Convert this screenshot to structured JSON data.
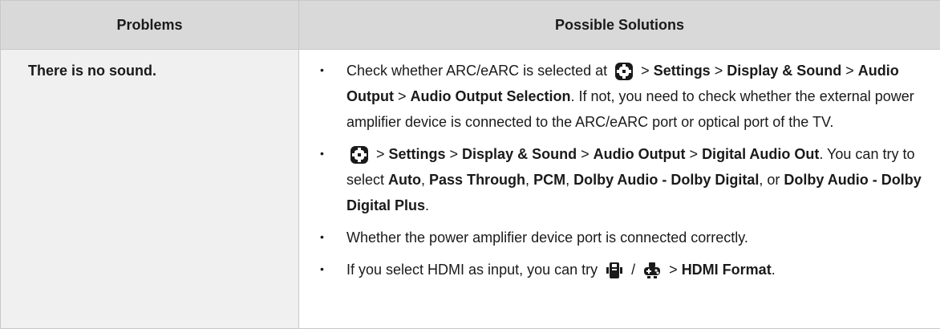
{
  "table": {
    "headers": [
      "Problems",
      "Possible Solutions"
    ],
    "rows": [
      {
        "problem": "There is no sound.",
        "solutions": [
          {
            "t1": "Check whether ARC/eARC is selected at",
            "icon": "settings-icon",
            "t2": " > ",
            "b1": "Settings",
            "t3": " > ",
            "b2": "Display & Sound",
            "t4": " > ",
            "b3": "Audio Output",
            "t5": " > ",
            "b4": "Audio Output Selection",
            "t6": ". If not, you need to check whether the external power amplifier device is connected to the ARC/eARC port or optical port of the TV."
          },
          {
            "icon": "settings-icon",
            "t1": " > ",
            "b1": "Settings",
            "t2": " > ",
            "b2": "Display & Sound",
            "t3": " > ",
            "b3": "Audio Output",
            "t4": " > ",
            "b4": "Digital Audio Out",
            "t5": ". You can try to select ",
            "b5": "Auto",
            "t6": ", ",
            "b6": "Pass Through",
            "t7": ", ",
            "b7": "PCM",
            "t8": ", ",
            "b8": "Dolby Audio - Dolby Digital",
            "t9": ", or ",
            "b9": "Dolby Audio - Dolby Digital Plus",
            "t10": "."
          },
          {
            "t1": "Whether the power amplifier device port is connected correctly."
          },
          {
            "t1": "If you select HDMI as input, you can try",
            "icon1": "input-icon",
            "t2": " / ",
            "icon2": "gamepad-icon",
            "t3": " > ",
            "b1": "HDMI Format",
            "t4": "."
          }
        ]
      }
    ]
  }
}
